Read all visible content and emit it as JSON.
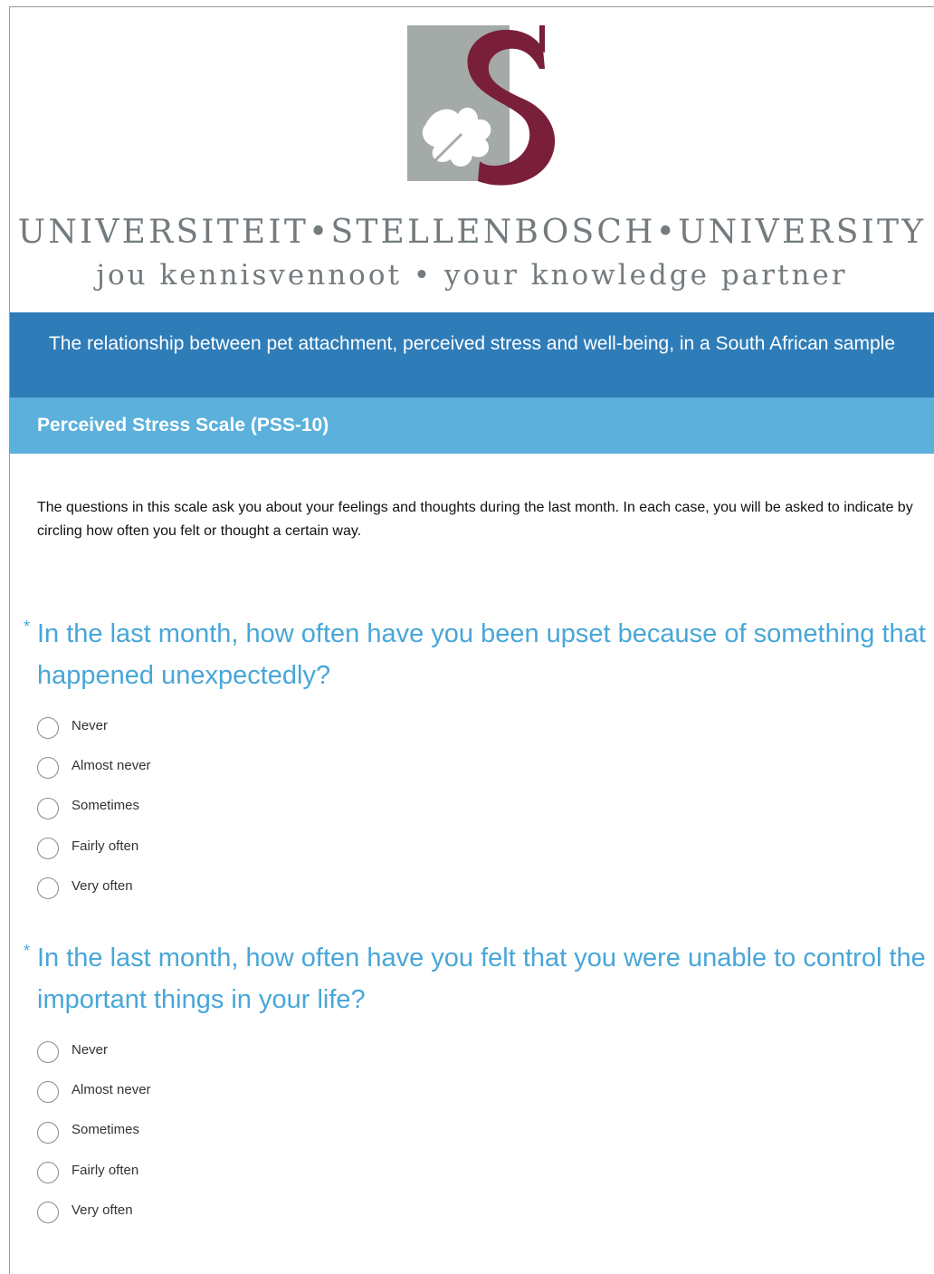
{
  "header": {
    "brand_colors": {
      "crest_grey": "#a4aaa8",
      "crest_maroon": "#7a1f3a",
      "text_grey": "#737b7f"
    },
    "wordmark": "UNIVERSITEIT•STELLENBOSCH•UNIVERSITY",
    "motto": "jou kennisvennoot • your knowledge partner",
    "crest_icon": "stellenbosch-crest-icon"
  },
  "survey": {
    "title": "The relationship between pet attachment, perceived stress and well-being, in a South African sample",
    "section_title": "Perceived Stress Scale (PSS-10)",
    "intro": "The questions in this scale ask you about your feelings and thoughts during the last month. In each case, you will be asked to indicate by circling how often you felt or thought a certain way.",
    "colors": {
      "title_band": "#2e7cb8",
      "section_band": "#5bb0dc",
      "question_text": "#48a6d8"
    }
  },
  "questions": [
    {
      "required_mark": "*",
      "text": "In the last month, how often have you been upset because of something that happened unexpectedly?",
      "options": [
        "Never",
        "Almost never",
        "Sometimes",
        "Fairly often",
        "Very often"
      ],
      "selected": null
    },
    {
      "required_mark": "*",
      "text": "In the last month, how often have you felt that you were unable to control the important things in your life?",
      "options": [
        "Never",
        "Almost never",
        "Sometimes",
        "Fairly often",
        "Very often"
      ],
      "selected": null
    }
  ]
}
